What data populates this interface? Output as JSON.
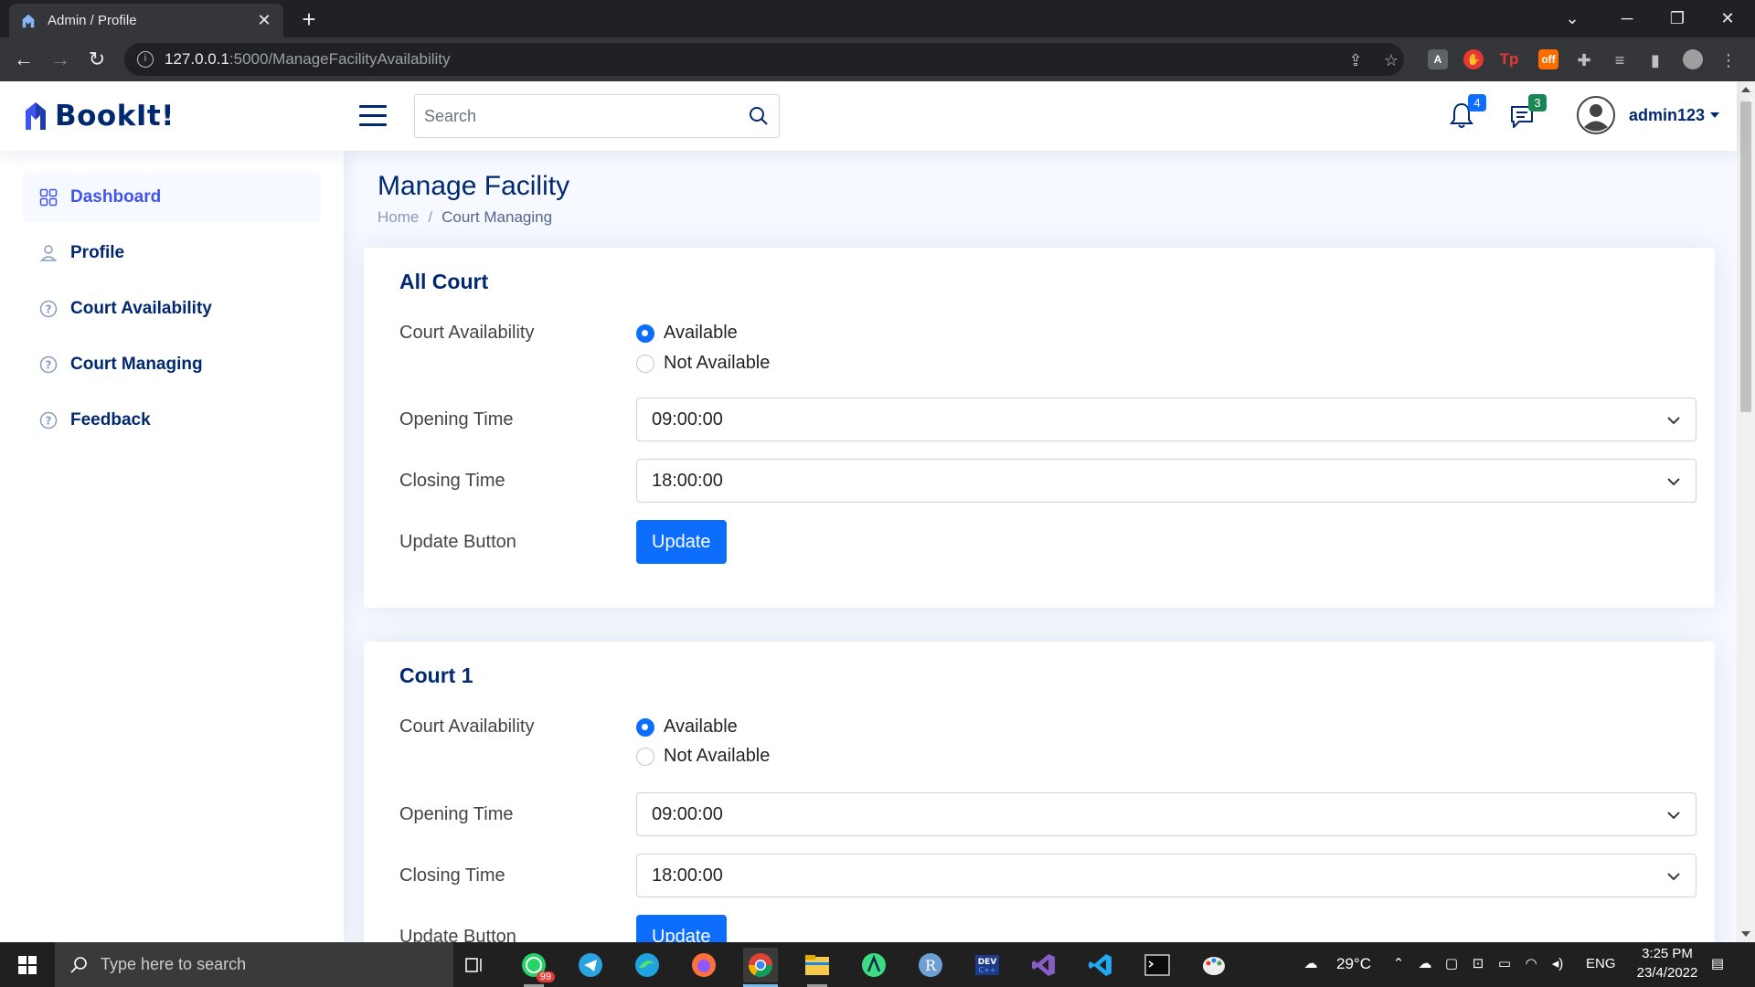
{
  "browser": {
    "tab_title": "Admin / Profile",
    "url_host": "127.0.0.1",
    "url_path": ":5000/ManageFacilityAvailability"
  },
  "header": {
    "logo_text": "BookIt!",
    "search_placeholder": "Search",
    "notifications_count": "4",
    "messages_count": "3",
    "username": "admin123",
    "colors": {
      "brand": "#012970",
      "accent": "#4154f1",
      "primary": "#0d6efd",
      "notif_badge": "#0d6efd",
      "msg_badge": "#198754"
    }
  },
  "sidebar": {
    "items": [
      {
        "label": "Dashboard",
        "icon": "grid-icon",
        "active": true
      },
      {
        "label": "Profile",
        "icon": "person-icon",
        "active": false
      },
      {
        "label": "Court Availability",
        "icon": "question-circle-icon",
        "active": false
      },
      {
        "label": "Court Managing",
        "icon": "question-circle-icon",
        "active": false
      },
      {
        "label": "Feedback",
        "icon": "question-circle-icon",
        "active": false
      }
    ]
  },
  "main": {
    "page_title": "Manage Facility",
    "breadcrumb": {
      "home": "Home",
      "separator": "/",
      "current": "Court Managing"
    },
    "cards": [
      {
        "title": "All Court",
        "availability_label": "Court Availability",
        "option_available": "Available",
        "option_not_available": "Not Available",
        "selected": "Available",
        "opening_label": "Opening Time",
        "opening_value": "09:00:00",
        "closing_label": "Closing Time",
        "closing_value": "18:00:00",
        "update_label": "Update Button",
        "update_button": "Update"
      },
      {
        "title": "Court 1",
        "availability_label": "Court Availability",
        "option_available": "Available",
        "option_not_available": "Not Available",
        "selected": "Available",
        "opening_label": "Opening Time",
        "opening_value": "09:00:00",
        "closing_label": "Closing Time",
        "closing_value": "18:00:00",
        "update_label": "Update Button",
        "update_button": "Update"
      }
    ]
  },
  "taskbar": {
    "search_text": "Type here to search",
    "whatsapp_badge": "99",
    "weather": "29°C",
    "language": "ENG",
    "time": "3:25 PM",
    "date": "23/4/2022"
  }
}
